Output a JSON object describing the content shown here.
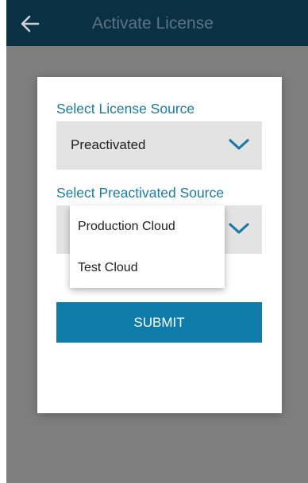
{
  "appbar": {
    "title": "Activate License",
    "back_icon": "arrow-left-icon"
  },
  "dialog": {
    "license_source": {
      "label": "Select License Source",
      "value": "Preactivated",
      "icon": "chevron-down-icon"
    },
    "preactivated_source": {
      "label": "Select Preactivated Source",
      "value": "",
      "icon": "chevron-down-icon"
    },
    "submit_label": "SUBMIT"
  },
  "dropdown": {
    "options": [
      "Production Cloud",
      "Test Cloud"
    ]
  },
  "colors": {
    "appbar": "#0a3044",
    "scrim": "#7e7e7e",
    "accent": "#1a7aa6",
    "button": "#0f7ba8",
    "select_bg": "#e3e3e3"
  }
}
